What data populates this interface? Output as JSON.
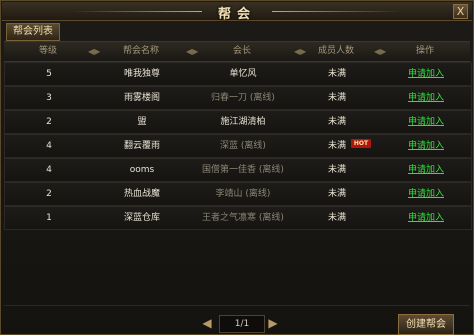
{
  "window": {
    "title": "帮会",
    "close_label": "X"
  },
  "tabs": [
    {
      "label": "帮会列表"
    }
  ],
  "columns": [
    "等级",
    "帮会名称",
    "会长",
    "成员人数",
    "操作"
  ],
  "rows": [
    {
      "level": "5",
      "guild": "唯我独尊",
      "leader": "单忆风",
      "leader_dim": false,
      "members": "未满",
      "hot": false,
      "action": "申请加入"
    },
    {
      "level": "3",
      "guild": "雨雾楼阁",
      "leader": "归春一刀 (离线)",
      "leader_dim": true,
      "members": "未满",
      "hot": false,
      "action": "申请加入"
    },
    {
      "level": "2",
      "guild": "盟",
      "leader": "施江湖清柏",
      "leader_dim": false,
      "members": "未满",
      "hot": false,
      "action": "申请加入"
    },
    {
      "level": "4",
      "guild": "翻云覆雨",
      "leader": "深蓝 (离线)",
      "leader_dim": true,
      "members": "未满",
      "hot": true,
      "hot_label": "HOT",
      "action": "申请加入"
    },
    {
      "level": "4",
      "guild": "ooms",
      "leader": "国僧第一佳香 (离线)",
      "leader_dim": true,
      "members": "未满",
      "hot": false,
      "action": "申请加入"
    },
    {
      "level": "2",
      "guild": "热血战魔",
      "leader": "李靖山 (离线)",
      "leader_dim": true,
      "members": "未满",
      "hot": false,
      "action": "申请加入"
    },
    {
      "level": "1",
      "guild": "深蓝仓库",
      "leader": "王者之气凛寒 (离线)",
      "leader_dim": true,
      "members": "未满",
      "hot": false,
      "action": "申请加入"
    }
  ],
  "pager": {
    "text": "1/1",
    "prev_icon": "◀",
    "next_icon": "▶"
  },
  "create_button": "创建帮会",
  "colors": {
    "link": "#2fe33a",
    "hot_badge": "#b0150f",
    "title": "#f3e2b4"
  }
}
